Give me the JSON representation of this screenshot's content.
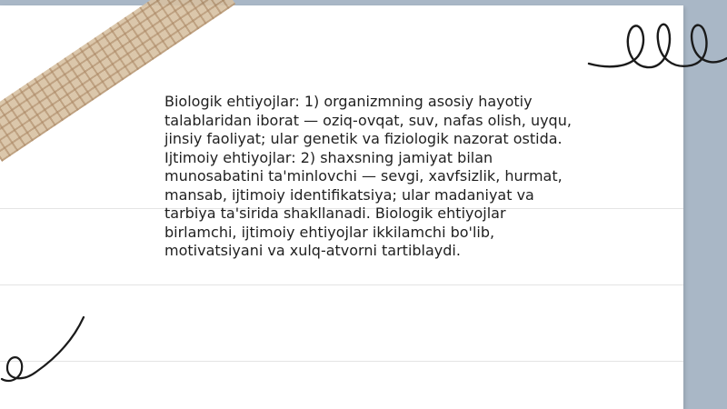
{
  "content": {
    "paragraph": "Biologik ehtiyojlar: 1) organizmning asosiy hayotiy talablaridan iborat — oziq-ovqat, suv, nafas olish, uyqu, jinsiy faoliyat; ular genetik va fiziologik nazorat ostida. Ijtimoiy ehtiyojlar: 2) shaxsning jamiyat bilan munosabatini ta'minlovchi — sevgi, xavfsizlik, hurmat, mansab, ijtimoiy identifikatsiya; ular madaniyat va tarbiya ta'sirida shakllanadi. Biologik ehtiyojlar birlamchi, ijtimoiy ehtiyojlar ikkilamchi bo'lib, motivatsiyani va xulq-atvorni tartiblaydi."
  },
  "colors": {
    "background": "#a9b7c6",
    "paper": "#ffffff",
    "text": "#1f1f1f",
    "rule_lines": "#e4e4e4",
    "tape": "#d8c2a3",
    "doodle_stroke": "#1a1a1a"
  },
  "decor": {
    "tape_icon": "washi-tape-icon",
    "loops_icon": "squiggle-loops-icon",
    "swirl_icon": "swirl-doodle-icon"
  }
}
